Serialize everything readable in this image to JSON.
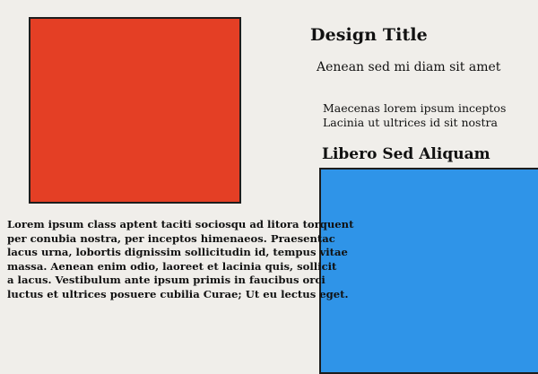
{
  "title": "Design Title",
  "subtitle": "Aenean sed mi diam sit amet",
  "small_text": [
    "Maecenas lorem ipsum inceptos",
    "Lacinia ut ultrices id sit nostra"
  ],
  "section_heading": "Libero Sed Aliquam",
  "body_lines": [
    "Lorem ipsum class aptent taciti sociosqu ad litora torquent",
    "per conubia nostra, per inceptos himenaeos. Praesentac",
    "lacus urna, lobortis dignissim sollicitudin id, tempus vitae",
    "massa. Aenean enim odio, laoreet et lacinia quis, sollicit",
    "a lacus. Vestibulum ante ipsum primis in faucibus orci",
    "luctus et ultrices posuere cubilia Curae; Ut eu lectus eget."
  ],
  "colors": {
    "background": "#f0eeea",
    "red_block": "#e43f25",
    "blue_block": "#2f94e8",
    "border": "#1d1d1d",
    "text": "#111111"
  }
}
